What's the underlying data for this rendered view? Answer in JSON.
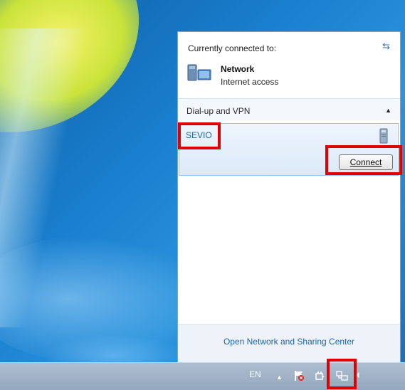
{
  "flyout": {
    "currently_connected_label": "Currently connected to:",
    "network_name": "Network",
    "network_status": "Internet access",
    "dialup_section_label": "Dial-up and VPN",
    "vpn_connection_name": "SEVIO",
    "connect_button_label": "Connect",
    "footer_link": "Open Network and Sharing Center"
  },
  "taskbar": {
    "language": "EN",
    "tray_icons": [
      "show-hidden-icons-icon",
      "action-center-icon",
      "power-icon",
      "network-icon",
      "volume-icon"
    ]
  },
  "colors": {
    "highlight": "#e00000",
    "link": "#1f63b3",
    "selected_item_bg": "#dbe9f8"
  }
}
